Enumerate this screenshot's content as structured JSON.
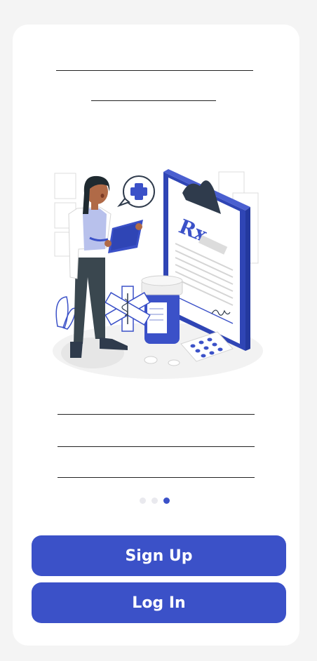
{
  "onboarding": {
    "pagination": {
      "total": 3,
      "active_index": 3
    },
    "illustration": {
      "rx_text": "Rx",
      "icon": "doctor-prescription-illustration"
    }
  },
  "actions": {
    "sign_up_label": "Sign Up",
    "log_in_label": "Log In"
  },
  "colors": {
    "accent": "#3b51c8",
    "background": "#f4f4f4",
    "card": "#ffffff"
  }
}
